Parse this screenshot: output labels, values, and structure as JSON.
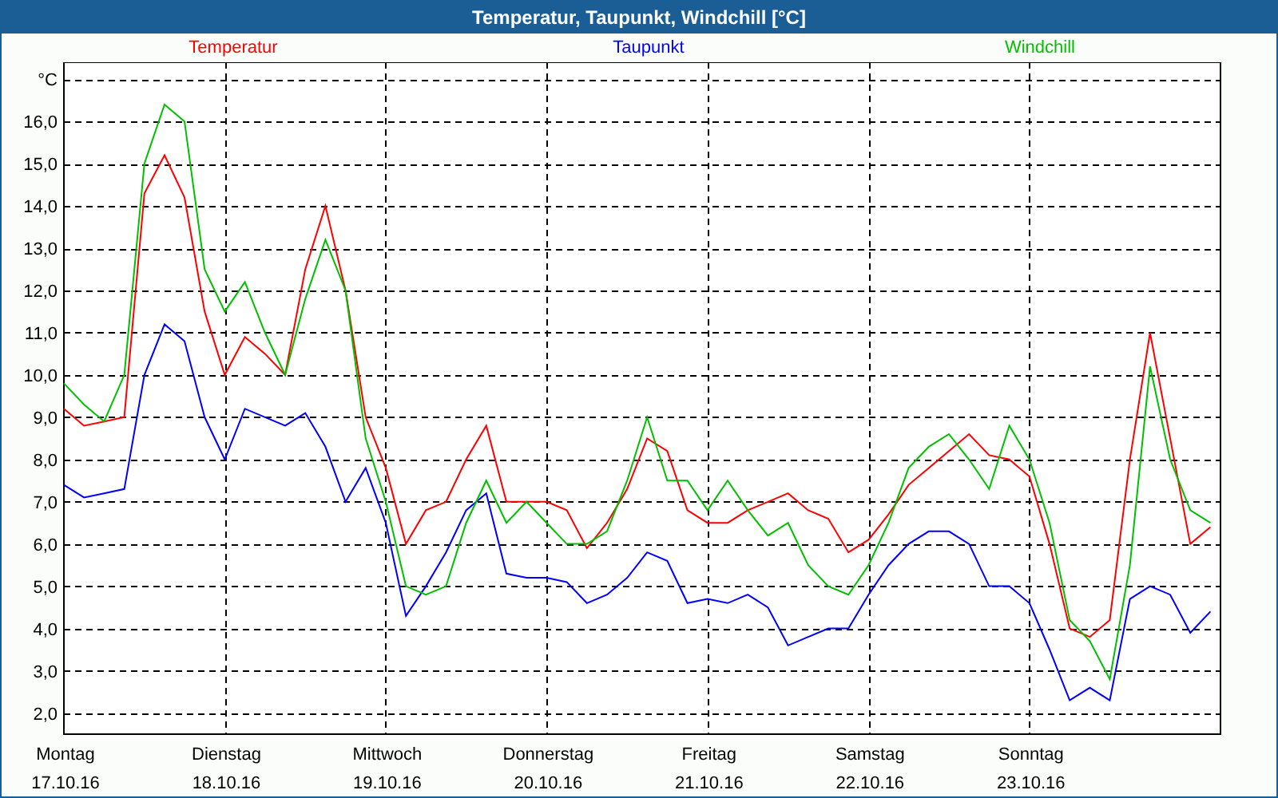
{
  "window": {
    "title": "Temperatur, Taupunkt, Windchill [°C]"
  },
  "chart": {
    "x_dates": [
      "17.10.16",
      "18.10.16",
      "19.10.16",
      "20.10.16",
      "21.10.16",
      "22.10.16",
      "23.10.16"
    ],
    "chart_data": {
      "type": "line",
      "grid": true,
      "ylabel": "°C",
      "ylim": [
        1.5,
        17.4
      ],
      "yticks": [
        {
          "value": 2,
          "label": "2,0"
        },
        {
          "value": 3,
          "label": "3,0"
        },
        {
          "value": 4,
          "label": "4,0"
        },
        {
          "value": 5,
          "label": "5,0"
        },
        {
          "value": 6,
          "label": "6,0"
        },
        {
          "value": 7,
          "label": "7,0"
        },
        {
          "value": 8,
          "label": "8,0"
        },
        {
          "value": 9,
          "label": "9,0"
        },
        {
          "value": 10,
          "label": "10,0"
        },
        {
          "value": 11,
          "label": "11,0"
        },
        {
          "value": 12,
          "label": "12,0"
        },
        {
          "value": 13,
          "label": "13,0"
        },
        {
          "value": 14,
          "label": "14,0"
        },
        {
          "value": 15,
          "label": "15,0"
        },
        {
          "value": 16,
          "label": "16,0"
        }
      ],
      "categories": [
        "Montag",
        null,
        null,
        null,
        null,
        null,
        null,
        null,
        "Dienstag",
        null,
        null,
        null,
        null,
        null,
        null,
        null,
        "Mittwoch",
        null,
        null,
        null,
        null,
        null,
        null,
        null,
        "Donnerstag",
        null,
        null,
        null,
        null,
        null,
        null,
        null,
        "Freitag",
        null,
        null,
        null,
        null,
        null,
        null,
        null,
        "Samstag",
        null,
        null,
        null,
        null,
        null,
        null,
        null,
        "Sonntag",
        null,
        null,
        null,
        null,
        null,
        null,
        null,
        null,
        null
      ],
      "series": [
        {
          "name": "Temperatur",
          "color": "#ff0000",
          "values": [
            9.2,
            8.8,
            8.9,
            9.0,
            14.3,
            15.2,
            14.2,
            11.5,
            10.0,
            10.9,
            10.5,
            10.0,
            12.5,
            14.0,
            12.0,
            9.0,
            7.8,
            6.0,
            6.8,
            7.0,
            8.0,
            8.8,
            7.0,
            7.0,
            7.0,
            6.8,
            5.9,
            6.5,
            7.3,
            8.5,
            8.2,
            6.8,
            6.5,
            6.5,
            6.8,
            7.0,
            7.2,
            6.8,
            6.6,
            5.8,
            6.1,
            6.7,
            7.4,
            7.8,
            8.2,
            8.6,
            8.1,
            8.0,
            7.6,
            6.0,
            4.0,
            3.8,
            4.2,
            8.0,
            11.0,
            8.5,
            6.0,
            6.4
          ]
        },
        {
          "name": "Taupunkt",
          "color": "#0000ff",
          "values": [
            7.4,
            7.1,
            7.2,
            7.3,
            10.0,
            11.2,
            10.8,
            9.0,
            8.0,
            9.2,
            9.0,
            8.8,
            9.1,
            8.3,
            7.0,
            7.8,
            6.5,
            4.3,
            5.0,
            5.8,
            6.8,
            7.2,
            5.3,
            5.2,
            5.2,
            5.1,
            4.6,
            4.8,
            5.2,
            5.8,
            5.6,
            4.6,
            4.7,
            4.6,
            4.8,
            4.5,
            3.6,
            3.8,
            4.0,
            4.0,
            4.8,
            5.5,
            6.0,
            6.3,
            6.3,
            6.0,
            5.0,
            5.0,
            4.6,
            3.5,
            2.3,
            2.6,
            2.3,
            4.7,
            5.0,
            4.8,
            3.9,
            4.4
          ]
        },
        {
          "name": "Windchill",
          "color": "#00c000",
          "values": [
            9.8,
            9.3,
            8.9,
            10.0,
            15.0,
            16.4,
            16.0,
            12.5,
            11.5,
            12.2,
            11.0,
            10.0,
            11.8,
            13.2,
            12.0,
            8.5,
            7.0,
            5.0,
            4.8,
            5.0,
            6.5,
            7.5,
            6.5,
            7.0,
            6.5,
            6.0,
            6.0,
            6.3,
            7.5,
            9.0,
            7.5,
            7.5,
            6.8,
            7.5,
            6.8,
            6.2,
            6.5,
            5.5,
            5.0,
            4.8,
            5.5,
            6.5,
            7.8,
            8.3,
            8.6,
            8.0,
            7.3,
            8.8,
            8.0,
            6.5,
            4.2,
            3.7,
            2.8,
            5.5,
            10.2,
            8.0,
            6.8,
            6.5
          ]
        }
      ]
    }
  }
}
